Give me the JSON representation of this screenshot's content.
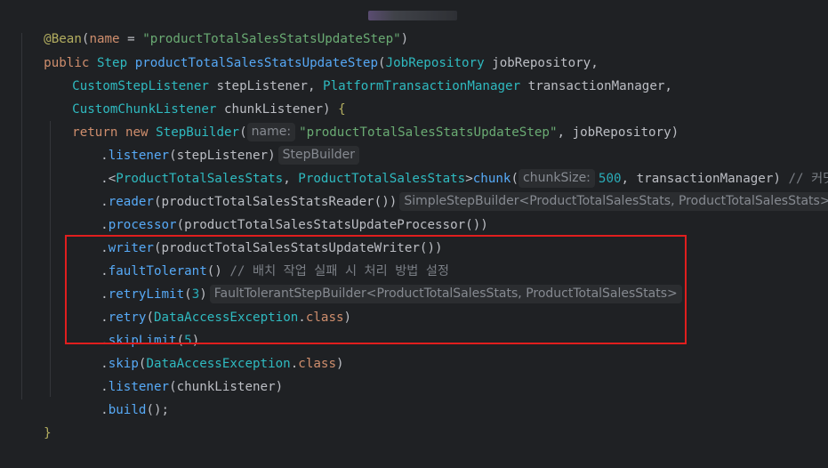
{
  "code": {
    "line1": {
      "annotation": "@Bean",
      "open": "(",
      "param": "name",
      "eq": " = ",
      "value": "\"productTotalSalesStatsUpdateStep\"",
      "close": ")"
    },
    "line2": {
      "public": "public",
      "type": "Step",
      "method": "productTotalSalesStatsUpdateStep",
      "open": "(",
      "ptype": "JobRepository",
      "pname": " jobRepository,",
      "ws": " "
    },
    "line3": {
      "t1": "CustomStepListener",
      "n1": " stepListener, ",
      "t2": "PlatformTransactionManager",
      "n2": " transactionManager,"
    },
    "line4": {
      "t1": "CustomChunkListener",
      "n1": " chunkListener) ",
      "brace": "{"
    },
    "line5": {
      "ret": "return",
      "new": " new ",
      "cls": "StepBuilder",
      "open": "(",
      "hint": "name:",
      "str": "\"productTotalSalesStatsUpdateStep\"",
      "rest": ", jobRepository)"
    },
    "line6": {
      "dot": ".",
      "m": "listener",
      "args": "(stepListener)",
      "hint": "StepBuilder"
    },
    "line7": {
      "dot": ".<",
      "t1": "ProductTotalSalesStats",
      "comma": ", ",
      "t2": "ProductTotalSalesStats",
      "gt": ">",
      "m": "chunk",
      "open": "(",
      "hint": "chunkSize:",
      "num": "500",
      "rest": ", transactionManager) ",
      "cmt": "// 커밋 단위"
    },
    "line8": {
      "dot": ".",
      "m": "reader",
      "args": "(productTotalSalesStatsReader())",
      "hint": "SimpleStepBuilder<ProductTotalSalesStats, ProductTotalSalesStats>"
    },
    "line9": {
      "dot": ".",
      "m": "processor",
      "args": "(productTotalSalesStatsUpdateProcessor())"
    },
    "line10": {
      "dot": ".",
      "m": "writer",
      "args": "(productTotalSalesStatsUpdateWriter())"
    },
    "line11": {
      "dot": ".",
      "m": "faultTolerant",
      "args": "() ",
      "cmt": "// 배치 작업 실패 시 처리 방법 설정"
    },
    "line12": {
      "dot": ".",
      "m": "retryLimit",
      "open": "(",
      "num": "3",
      "close": ")",
      "hint": "FaultTolerantStepBuilder<ProductTotalSalesStats, ProductTotalSalesStats>"
    },
    "line13": {
      "dot": ".",
      "m": "retry",
      "open": "(",
      "cls": "DataAccessException",
      "dotc": ".",
      "kw": "class",
      "close": ")"
    },
    "line14": {
      "dot": ".",
      "m": "skipLimit",
      "open": "(",
      "num": "5",
      "close": ")"
    },
    "line15": {
      "dot": ".",
      "m": "skip",
      "open": "(",
      "cls": "DataAccessException",
      "dotc": ".",
      "kw": "class",
      "close": ")"
    },
    "line16": {
      "dot": ".",
      "m": "listener",
      "args": "(chunkListener)"
    },
    "line17": {
      "dot": ".",
      "m": "build",
      "args": "();"
    },
    "line18": {
      "brace": "}"
    }
  },
  "colors": {
    "background": "#1f2124",
    "keyword": "#cf8e6d",
    "type": "#2fbac0",
    "method": "#56a8f5",
    "string": "#6aab73",
    "number": "#2aacb8",
    "comment": "#7a7e85",
    "annotation": "#b3ae60",
    "highlight_box": "#e01e1e"
  }
}
